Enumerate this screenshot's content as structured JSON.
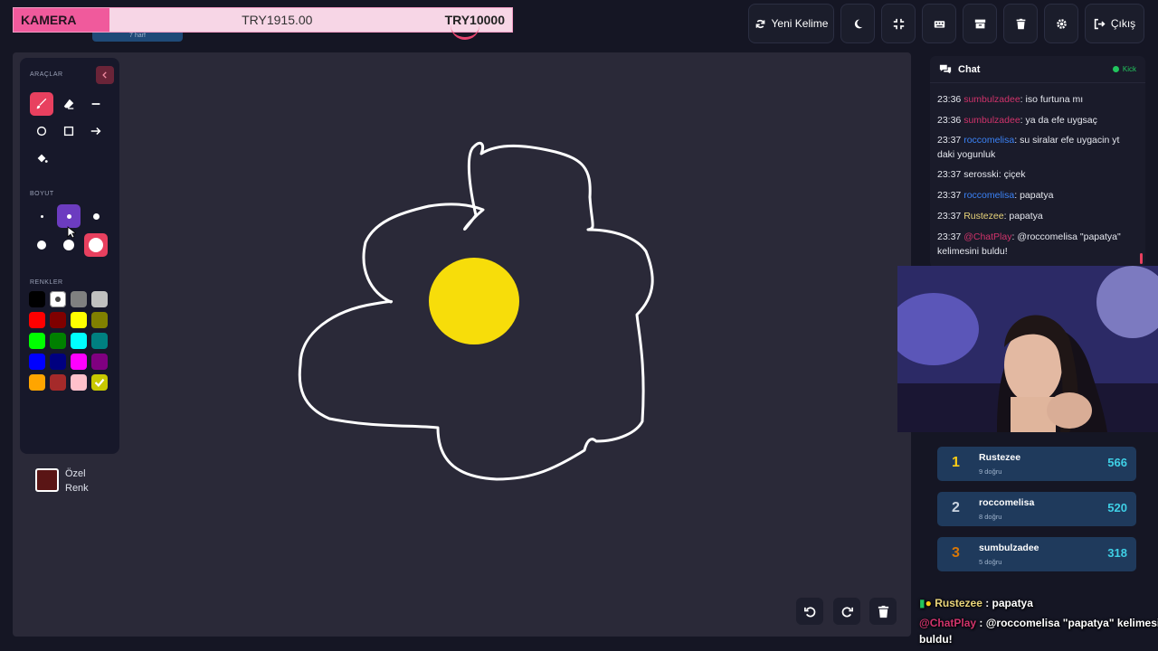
{
  "banner": {
    "label": "KAMERA",
    "current": "TRY1915.00",
    "goal": "TRY10000",
    "hint": "7 harf"
  },
  "toolbar": {
    "new_word": "Yeni Kelime",
    "exit": "Çıkış"
  },
  "tools": {
    "section_tools": "ARAÇLAR",
    "section_size": "BOYUT",
    "section_colors": "RENKLER",
    "custom_color": "Özel Renk",
    "colors": [
      "#000000",
      "#ffffff",
      "#808080",
      "#c0c0c0",
      "#ff0000",
      "#800000",
      "#ffff00",
      "#808000",
      "#00ff00",
      "#008000",
      "#00ffff",
      "#008080",
      "#0000ff",
      "#000080",
      "#ff00ff",
      "#800080",
      "#ffa500",
      "#a52a2a",
      "#ffc0cb",
      "#c8c800"
    ]
  },
  "chat": {
    "title": "Chat",
    "platform": "Kick",
    "messages": [
      {
        "time": "23:36",
        "user": "sumbulzadee",
        "color": "#d1336b",
        "text": "iso furtuna mı"
      },
      {
        "time": "23:36",
        "user": "sumbulzadee",
        "color": "#d1336b",
        "text": "ya da efe uygsaç"
      },
      {
        "time": "23:37",
        "user": "roccomelisa",
        "color": "#3b82f6",
        "text": "su siralar efe uygacin yt daki yogunluk"
      },
      {
        "time": "23:37",
        "user": "serosski",
        "color": "#e6e8ef",
        "text": "çiçek"
      },
      {
        "time": "23:37",
        "user": "roccomelisa",
        "color": "#3b82f6",
        "text": "papatya"
      },
      {
        "time": "23:37",
        "user": "Rustezee",
        "color": "#e9d47a",
        "text": "papatya"
      },
      {
        "time": "23:37",
        "user": "@ChatPlay",
        "color": "#d1336b",
        "text": "@roccomelisa \"papatya\" kelimesini buldu!"
      }
    ]
  },
  "leaderboard": [
    {
      "rank": "1",
      "name": "Rustezee",
      "sub": "9 doğru",
      "points": "566",
      "rank_color": "#facc15"
    },
    {
      "rank": "2",
      "name": "roccomelisa",
      "sub": "8 doğru",
      "points": "520",
      "rank_color": "#cbd5e1"
    },
    {
      "rank": "3",
      "name": "sumbulzadee",
      "sub": "5 doğru",
      "points": "318",
      "rank_color": "#d97706"
    }
  ],
  "overlay": {
    "line1_user": "Rustezee",
    "line1_text": " : papatya",
    "line2_user": "@ChatPlay",
    "line2_text": " : @roccomelisa \"papatya\" kelimesini",
    "line2_cont": "buldu!"
  }
}
